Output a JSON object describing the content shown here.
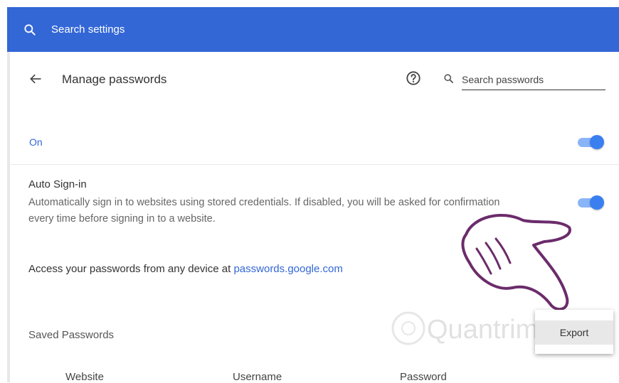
{
  "topbar": {
    "search_placeholder": "Search settings",
    "background": "#3367d6"
  },
  "header": {
    "title": "Manage passwords",
    "search_placeholder": "Search passwords",
    "back_icon": "arrow-left-icon",
    "help_icon": "help-circle-icon"
  },
  "on_row": {
    "label": "On",
    "enabled": true
  },
  "auto_signin": {
    "title": "Auto Sign-in",
    "description": "Automatically sign in to websites using stored credentials. If disabled, you will be asked for confirmation every time before signing in to a website.",
    "enabled": true
  },
  "access": {
    "text": "Access your passwords from any device at ",
    "link": "passwords.google.com"
  },
  "saved": {
    "title": "Saved Passwords",
    "columns": [
      "Website",
      "Username",
      "Password"
    ]
  },
  "export_menu": {
    "export_label": "Export"
  },
  "watermark_text": "Quantrimang",
  "colors": {
    "accent": "#3367d6",
    "toggle_track": "#8ab4f8",
    "toggle_knob": "#3a7ff0"
  }
}
